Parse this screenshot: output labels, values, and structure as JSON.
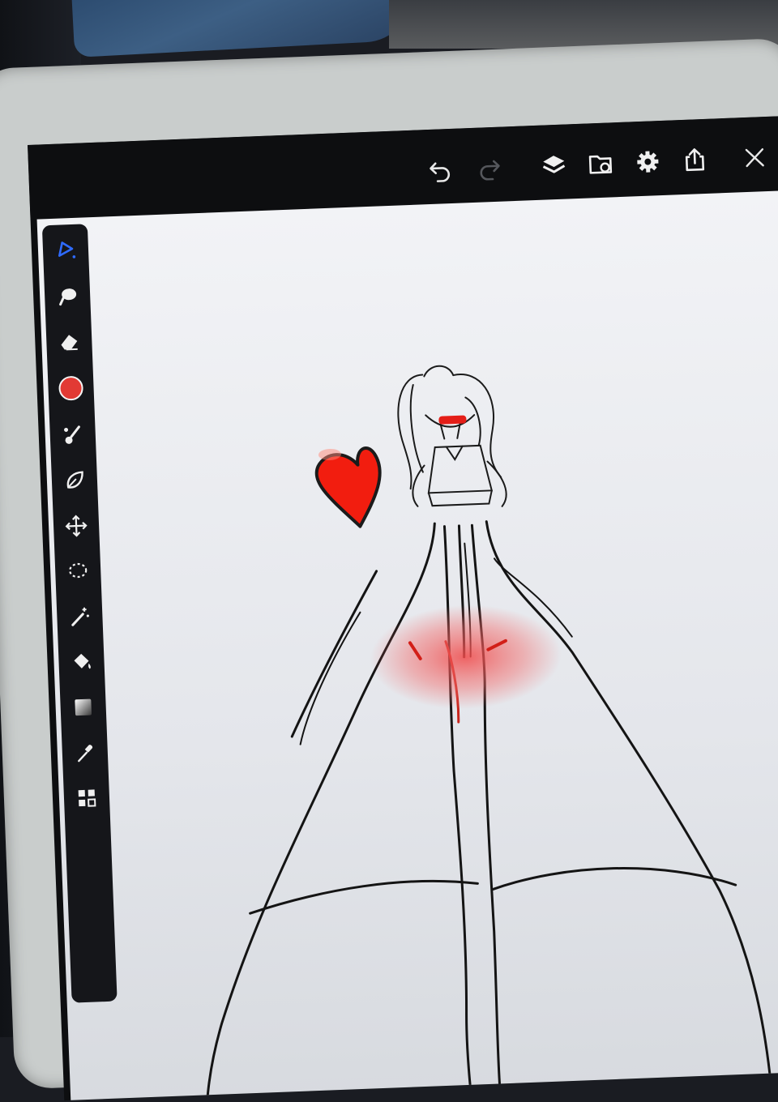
{
  "app": {
    "name": "",
    "accent_color": "#2f6bff",
    "brush_color": "#e23a34"
  },
  "topbar": {
    "buttons": [
      {
        "name": "undo",
        "icon": "undo-icon"
      },
      {
        "name": "redo",
        "icon": "redo-icon",
        "disabled": true
      },
      {
        "name": "layers",
        "icon": "layers-icon"
      },
      {
        "name": "gallery",
        "icon": "folder-icon"
      },
      {
        "name": "settings",
        "icon": "gear-icon"
      },
      {
        "name": "export",
        "icon": "share-icon"
      },
      {
        "name": "close",
        "icon": "close-icon"
      }
    ]
  },
  "toolbar": {
    "tools": [
      {
        "name": "pen",
        "icon": "pen-icon",
        "active": true
      },
      {
        "name": "smudge",
        "icon": "smudge-icon"
      },
      {
        "name": "eraser",
        "icon": "eraser-icon"
      },
      {
        "name": "color",
        "icon": "color-swatch-icon"
      },
      {
        "name": "brush-settings",
        "icon": "brush-icon"
      },
      {
        "name": "liquify",
        "icon": "leaf-icon"
      },
      {
        "name": "transform",
        "icon": "move-icon"
      },
      {
        "name": "lasso",
        "icon": "lasso-icon"
      },
      {
        "name": "magic-wand",
        "icon": "magic-wand-icon"
      },
      {
        "name": "fill",
        "icon": "paint-bucket-icon"
      },
      {
        "name": "gradient",
        "icon": "gradient-icon"
      },
      {
        "name": "eyedropper",
        "icon": "eyedropper-icon"
      },
      {
        "name": "more",
        "icon": "grid-icon"
      }
    ]
  },
  "canvas": {
    "content": "line-drawing",
    "ink_color": "#1b1b1b",
    "accent_color": "#e23a34"
  }
}
